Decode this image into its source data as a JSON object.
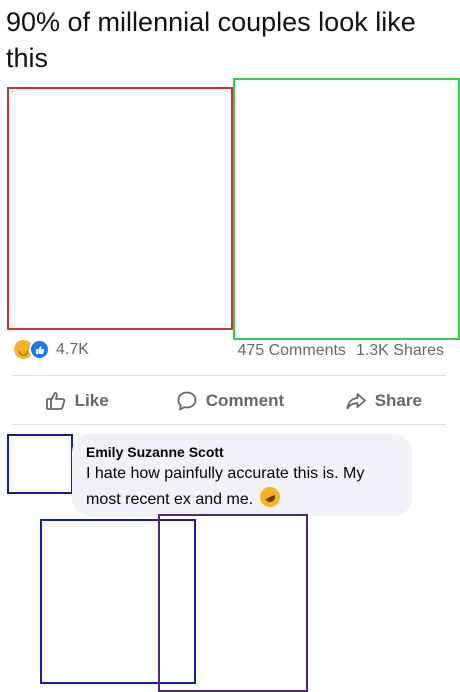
{
  "post": {
    "title": "90% of millennial couples look like this"
  },
  "images": {
    "left_border_color": "#d32f2f",
    "right_border_color": "#2ecc40"
  },
  "stats": {
    "reactions": [
      "haha",
      "like"
    ],
    "reaction_count": "4.7K",
    "comments": "475 Comments",
    "shares": "1.3K Shares"
  },
  "actions": {
    "like": "Like",
    "comment": "Comment",
    "share": "Share"
  },
  "comment": {
    "author": "Emily Suzanne Scott",
    "text": "I hate how painfully accurate this is. My most recent ex and me.",
    "emoji": "rolling-on-floor-laughing"
  },
  "colors": {
    "avatar_border": "#1a1aa8",
    "photo_blue_border": "#1a1aa8",
    "photo_purple_border": "#4b2a7a"
  }
}
